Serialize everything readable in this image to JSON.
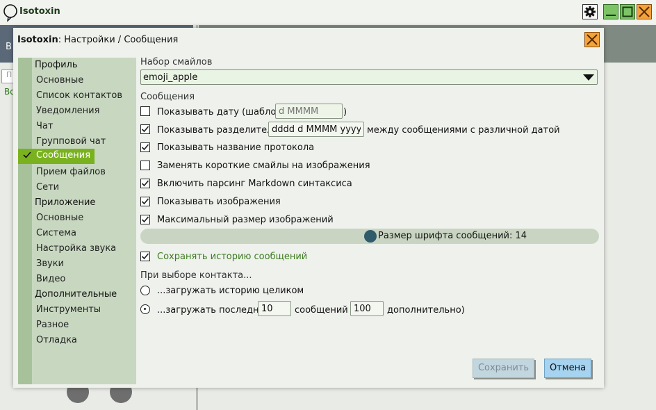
{
  "app": {
    "title": "Isotoxin",
    "bg_left_text": "B",
    "bg_input_placeholder": "П",
    "bg_green_text": "Во"
  },
  "dialog": {
    "title_app": "Isotoxin",
    "title_path": ": Настройки / Сообщения",
    "save_label": "Сохранить",
    "cancel_label": "Отмена"
  },
  "sidebar": {
    "items": [
      {
        "label": "Профиль",
        "header": true
      },
      {
        "label": "Основные"
      },
      {
        "label": "Список контактов"
      },
      {
        "label": "Уведомления"
      },
      {
        "label": "Чат"
      },
      {
        "label": "Групповой чат"
      },
      {
        "label": "Сообщения",
        "selected": true
      },
      {
        "label": "Прием файлов"
      },
      {
        "label": "Сети"
      },
      {
        "label": "Приложение",
        "header": true
      },
      {
        "label": "Основные"
      },
      {
        "label": "Система"
      },
      {
        "label": "Настройка звука"
      },
      {
        "label": "Звуки"
      },
      {
        "label": "Видео"
      },
      {
        "label": "Дополнительные",
        "header": true
      },
      {
        "label": "Инструменты"
      },
      {
        "label": "Разное"
      },
      {
        "label": "Отладка"
      }
    ]
  },
  "emoji": {
    "label": "Набор смайлов",
    "selected": "emoji_apple"
  },
  "messages": {
    "section_label": "Сообщения",
    "show_date_label": "Показывать дату (шаблон:",
    "show_date_close": ")",
    "date_template_placeholder": "d MMMM",
    "show_separator_label": "Показывать разделитель",
    "separator_template": "dddd d MMMM yyyy",
    "separator_suffix": "между сообщениями с различной датой",
    "show_protocol_label": "Показывать название протокола",
    "replace_smiles_label": "Заменять короткие смайлы на изображения",
    "markdown_label": "Включить парсинг Markdown синтаксиса",
    "show_images_label": "Показывать изображения",
    "max_image_label": "Максимальный размер изображений",
    "font_size_label": "Размер шрифта сообщений: 14",
    "save_history_label": "Сохранять историю сообщений"
  },
  "contact": {
    "section_label": "При выборе контакта...",
    "load_all_label": "...загружать историю целиком",
    "load_last_prefix": "...загружать последние",
    "load_last_value": "10",
    "load_last_mid": "сообщений (",
    "additional_value": "100",
    "additional_suffix": "дополнительно)"
  },
  "colors": {
    "accent_green": "#7ab21f",
    "sidebar_bg": "#c8d8c0",
    "close_orange": "#f4a23a",
    "cancel_blue": "#a6d3ef",
    "history_green": "#3e7b21"
  }
}
